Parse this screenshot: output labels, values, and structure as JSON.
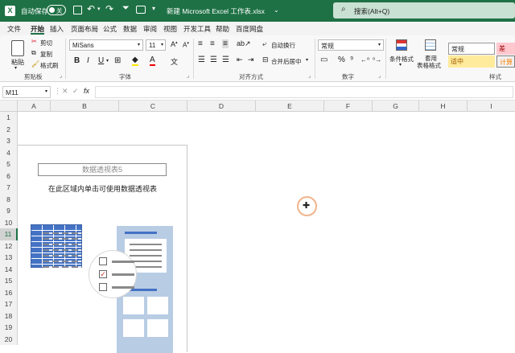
{
  "titlebar": {
    "autosave_label": "自动保存",
    "autosave_toggle": "关",
    "filename": "新建 Microsoft Excel 工作表.xlsx",
    "search_placeholder": "搜索(Alt+Q)"
  },
  "menu": [
    "文件",
    "开始",
    "插入",
    "页面布局",
    "公式",
    "数据",
    "审阅",
    "视图",
    "开发工具",
    "帮助",
    "百度网盘"
  ],
  "menu_active": "开始",
  "ribbon": {
    "paste": "粘贴",
    "cut": "剪切",
    "copy": "复制",
    "format_painter": "格式刷",
    "font_name": "MiSans",
    "font_size": "11",
    "wrap_text": "自动换行",
    "merge_center": "合并后居中",
    "number_format": "常规",
    "conditional_format": "条件格式",
    "table_format_1": "套用",
    "table_format_2": "表格格式",
    "style_normal": "常规",
    "style_bad": "差",
    "style_neutral": "适中",
    "style_calc": "计算",
    "groups": {
      "clipboard": "剪贴板",
      "font": "字体",
      "alignment": "对齐方式",
      "number": "数字",
      "styles": "样式"
    }
  },
  "formula_bar": {
    "name_box": "M11",
    "fx": "fx",
    "value": ""
  },
  "columns": [
    "A",
    "B",
    "C",
    "D",
    "E",
    "F",
    "G",
    "H",
    "I"
  ],
  "rows": [
    "1",
    "2",
    "3",
    "4",
    "5",
    "6",
    "7",
    "8",
    "9",
    "10",
    "11",
    "12",
    "13",
    "14",
    "15",
    "16",
    "17",
    "18",
    "19",
    "20"
  ],
  "active_row": "11",
  "pivot": {
    "title": "数据透视表5",
    "hint": "在此区域内单击可使用数据透视表"
  },
  "colors": {
    "title_green": "#1e7145",
    "pivot_blue": "#4472c4",
    "cursor_ring": "#f0b48c"
  }
}
